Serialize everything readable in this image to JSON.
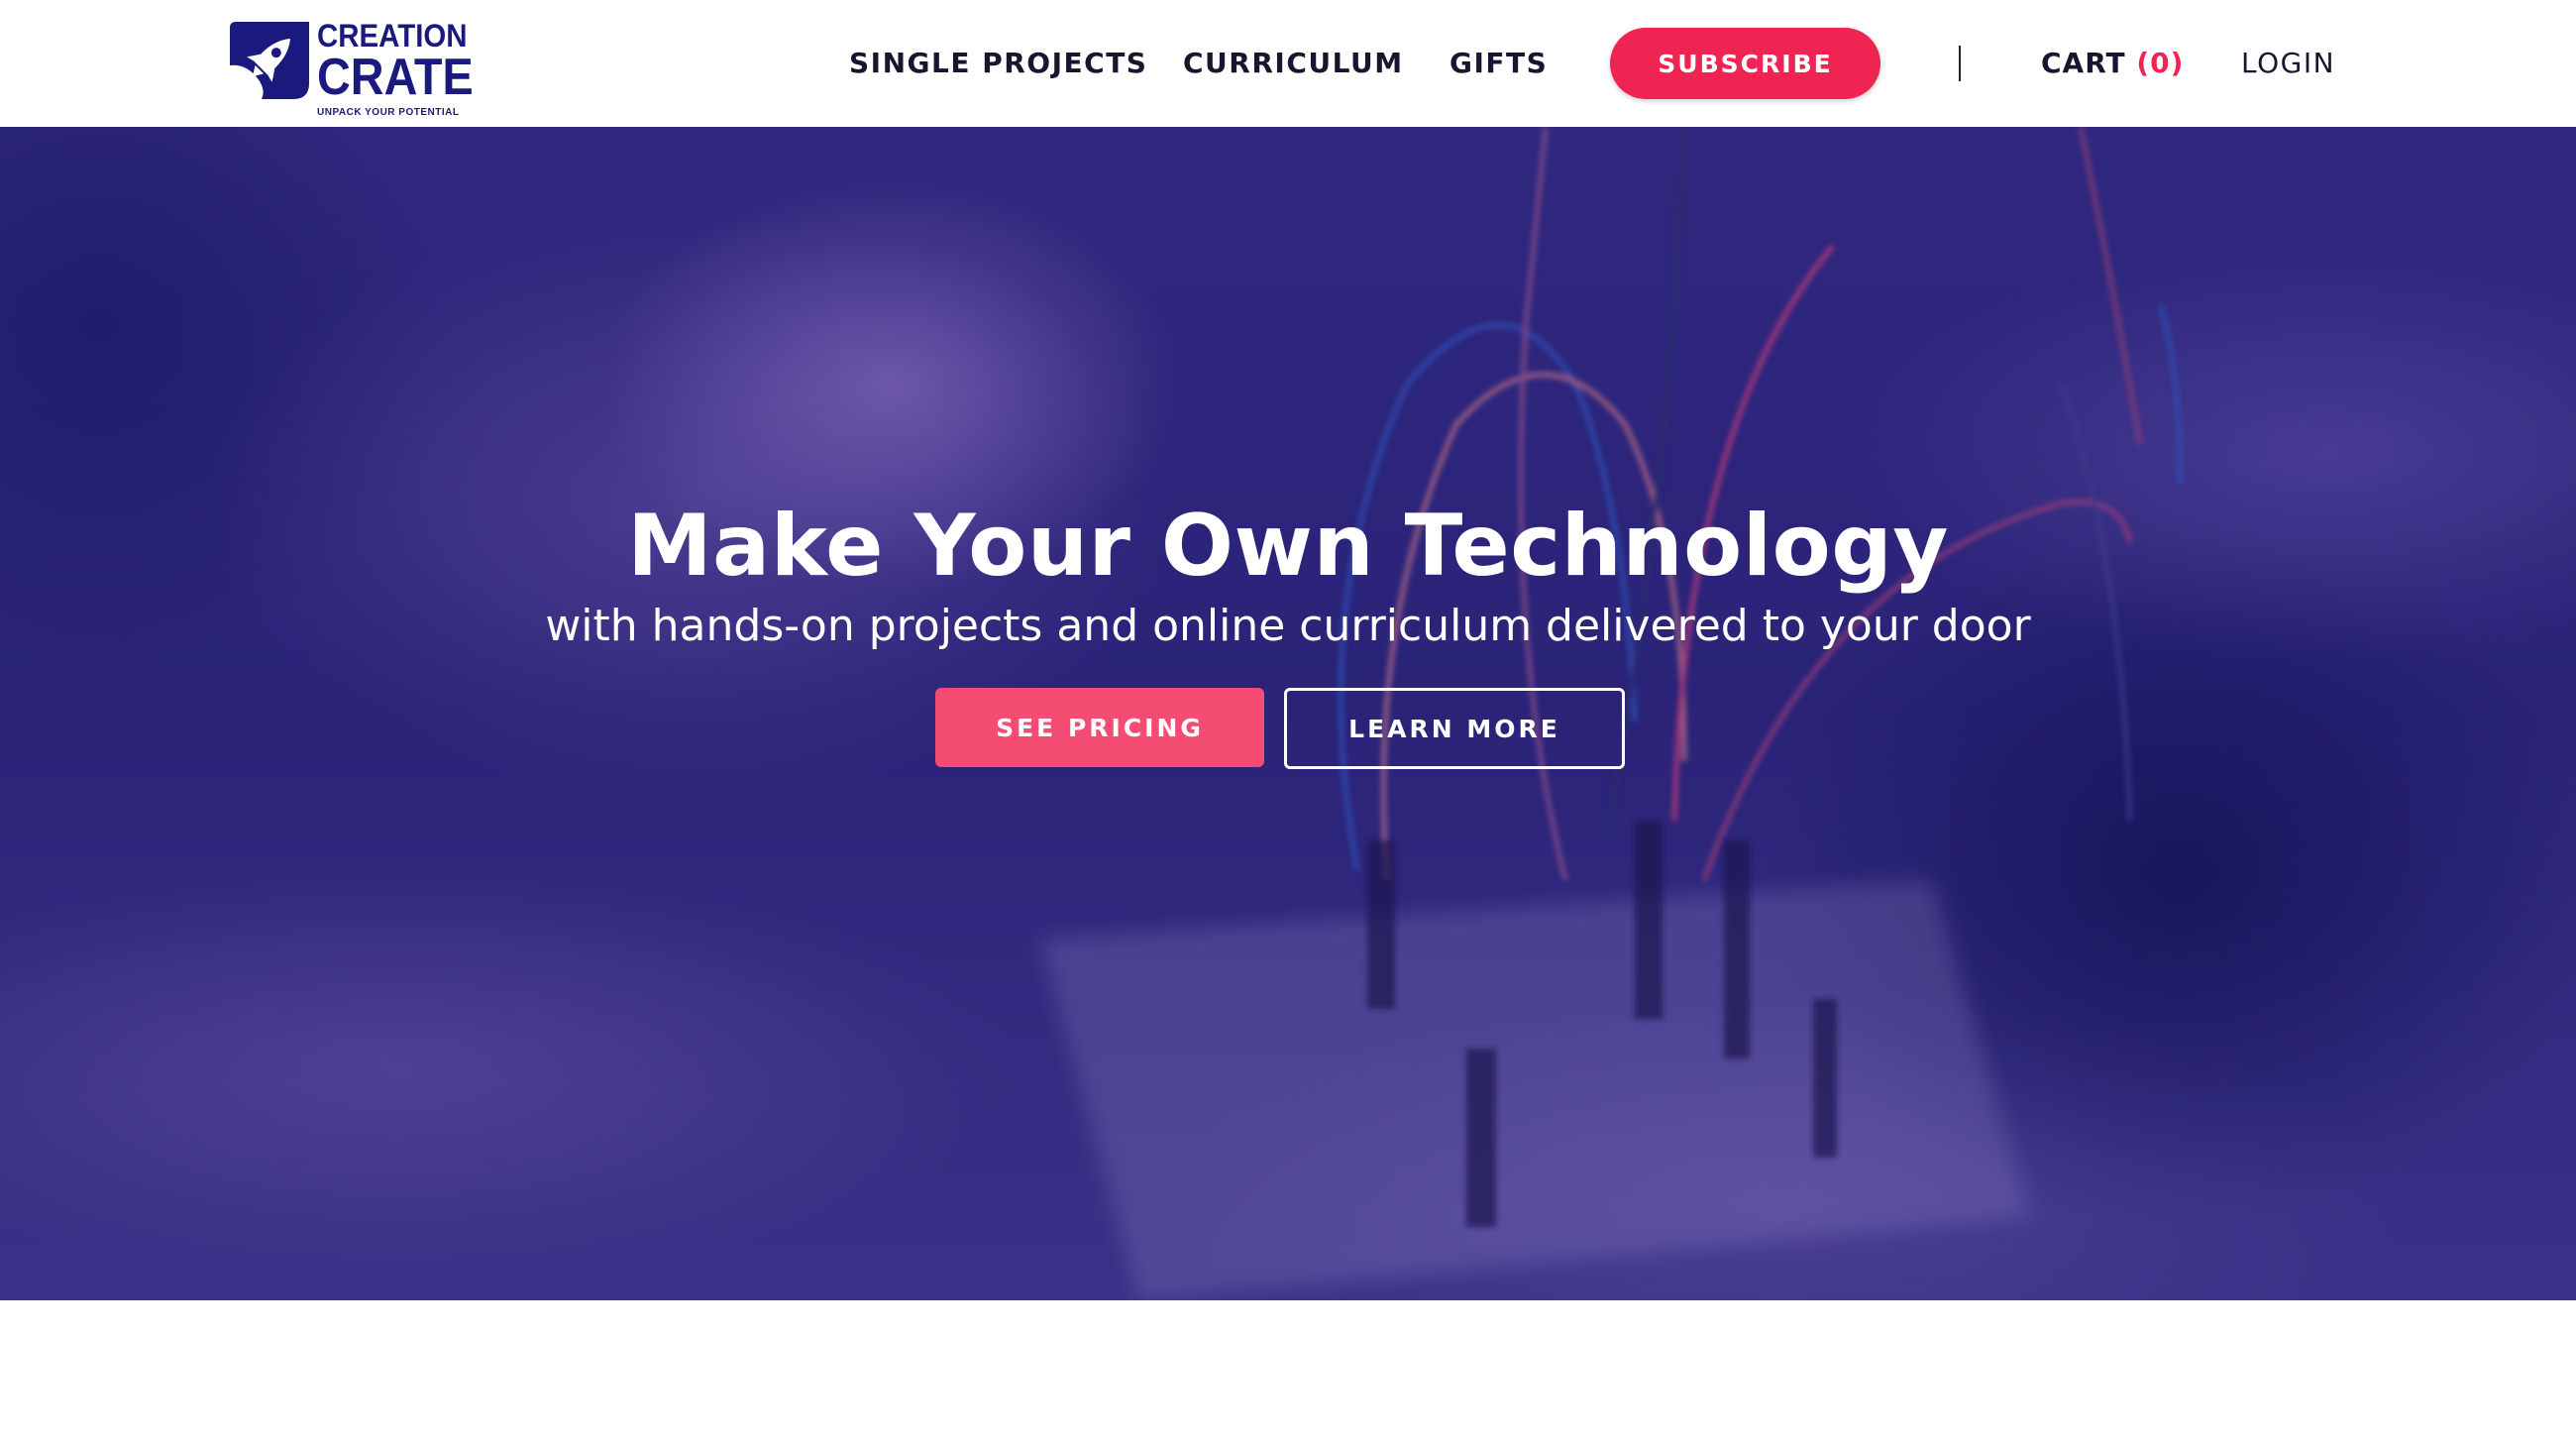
{
  "brand": {
    "name_line1": "CREATION",
    "name_line2": "CRATE",
    "tagline": "UNPACK YOUR POTENTIAL",
    "color": "#1a1a7e"
  },
  "nav": {
    "items": [
      {
        "label": "SINGLE PROJECTS"
      },
      {
        "label": "CURRICULUM"
      },
      {
        "label": "GIFTS"
      }
    ],
    "subscribe_label": "SUBSCRIBE",
    "cart_label": "CART",
    "cart_count": "(0)",
    "login_label": "LOGIN"
  },
  "hero": {
    "title": "Make Your Own Technology",
    "subtitle": "with hands-on projects and online curriculum delivered to your door",
    "primary_cta": "SEE PRICING",
    "secondary_cta": "LEARN MORE"
  },
  "colors": {
    "accent": "#ef2452",
    "cta": "#f44c73",
    "hero_overlay": "#2a2378",
    "text_dark": "#16162e"
  },
  "icons": {
    "logo": "rocket-icon"
  }
}
